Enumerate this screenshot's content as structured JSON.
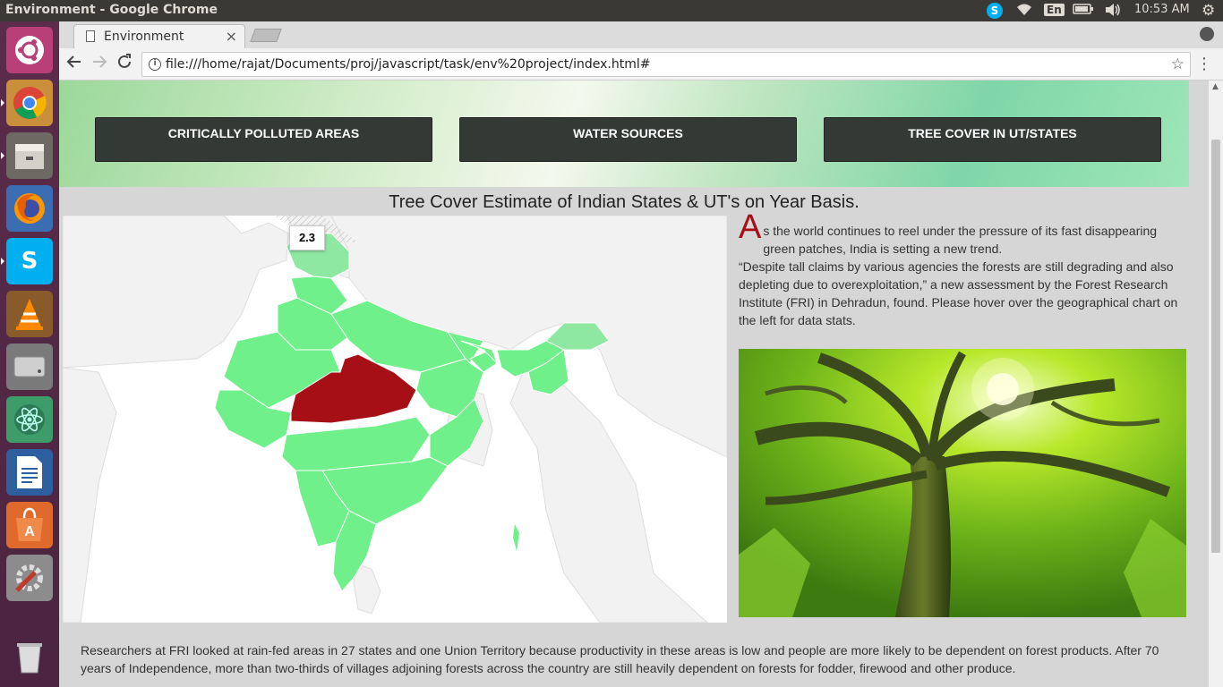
{
  "window": {
    "title": "Environment - Google Chrome"
  },
  "indicators": {
    "lang": "En",
    "clock": "10:53 AM"
  },
  "launcher": {
    "items": [
      "ubuntu-dash-icon",
      "chrome-icon",
      "files-icon",
      "firefox-icon",
      "skype-icon",
      "vlc-icon",
      "disk-icon",
      "atom-icon",
      "writer-icon",
      "software-center-icon",
      "settings-icon",
      "trash-icon"
    ]
  },
  "browser": {
    "tab_title": "Environment",
    "tab_close": "×",
    "url": "file:///home/rajat/Documents/proj/javascript/task/env%20project/index.html#"
  },
  "page": {
    "nav_buttons": [
      "CRITICALLY POLLUTED AREAS",
      "WATER SOURCES",
      "TREE COVER IN UT/STATES"
    ],
    "heading": "Tree Cover Estimate of Indian States & UT's on Year Basis.",
    "tooltip_value": "2.3",
    "drop_cap": "A",
    "para_line1": "s the world continues to reel under the pressure of its fast disappearing green patches, India is setting a new trend.",
    "para_line2": "“Despite tall claims by various agencies the forests are still degrading and also depleting due to overexploitation,” a new assessment by the Forest Research Institute (FRI) in Dehradun, found. Please hover over the geographical chart on the left for data stats.",
    "bottom_text": "Researchers at FRI looked at rain-fed areas in 27 states and one Union Territory because productivity in these areas is low and people are more likely to be dependent on forest products. After 70 years of Independence, more than two-thirds of villages adjoining forests across the country are still heavily dependent on forests for fodder, firewood and other produce."
  },
  "colors": {
    "highlight_state": "#a50f15",
    "state_fill": "#6ff08a",
    "accent_light": "#8ee8a2"
  }
}
